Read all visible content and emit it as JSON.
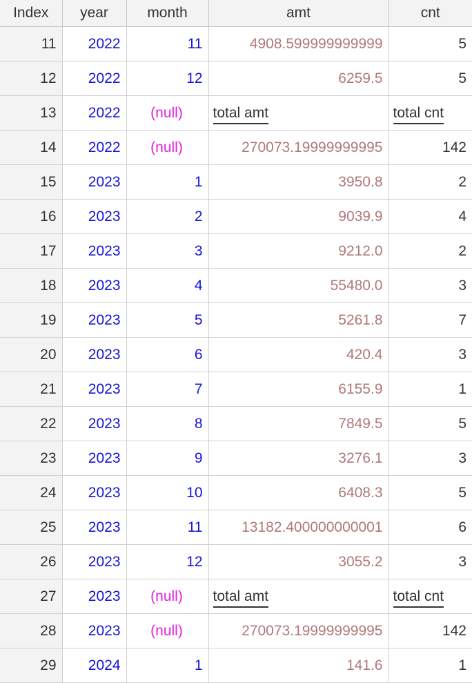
{
  "columns": [
    "Index",
    "year",
    "month",
    "amt",
    "cnt"
  ],
  "rows": [
    {
      "index": "11",
      "year": "2022",
      "month": "11",
      "amt": "4908.599999999999",
      "cnt": "5",
      "month_null": false,
      "label_row": false
    },
    {
      "index": "12",
      "year": "2022",
      "month": "12",
      "amt": "6259.5",
      "cnt": "5",
      "month_null": false,
      "label_row": false
    },
    {
      "index": "13",
      "year": "2022",
      "month": "(null)",
      "amt": "total amt",
      "cnt": "total cnt",
      "month_null": true,
      "label_row": true
    },
    {
      "index": "14",
      "year": "2022",
      "month": "(null)",
      "amt": "270073.19999999995",
      "cnt": "142",
      "month_null": true,
      "label_row": false
    },
    {
      "index": "15",
      "year": "2023",
      "month": "1",
      "amt": "3950.8",
      "cnt": "2",
      "month_null": false,
      "label_row": false
    },
    {
      "index": "16",
      "year": "2023",
      "month": "2",
      "amt": "9039.9",
      "cnt": "4",
      "month_null": false,
      "label_row": false
    },
    {
      "index": "17",
      "year": "2023",
      "month": "3",
      "amt": "9212.0",
      "cnt": "2",
      "month_null": false,
      "label_row": false
    },
    {
      "index": "18",
      "year": "2023",
      "month": "4",
      "amt": "55480.0",
      "cnt": "3",
      "month_null": false,
      "label_row": false
    },
    {
      "index": "19",
      "year": "2023",
      "month": "5",
      "amt": "5261.8",
      "cnt": "7",
      "month_null": false,
      "label_row": false
    },
    {
      "index": "20",
      "year": "2023",
      "month": "6",
      "amt": "420.4",
      "cnt": "3",
      "month_null": false,
      "label_row": false
    },
    {
      "index": "21",
      "year": "2023",
      "month": "7",
      "amt": "6155.9",
      "cnt": "1",
      "month_null": false,
      "label_row": false
    },
    {
      "index": "22",
      "year": "2023",
      "month": "8",
      "amt": "7849.5",
      "cnt": "5",
      "month_null": false,
      "label_row": false
    },
    {
      "index": "23",
      "year": "2023",
      "month": "9",
      "amt": "3276.1",
      "cnt": "3",
      "month_null": false,
      "label_row": false
    },
    {
      "index": "24",
      "year": "2023",
      "month": "10",
      "amt": "6408.3",
      "cnt": "5",
      "month_null": false,
      "label_row": false
    },
    {
      "index": "25",
      "year": "2023",
      "month": "11",
      "amt": "13182.400000000001",
      "cnt": "6",
      "month_null": false,
      "label_row": false
    },
    {
      "index": "26",
      "year": "2023",
      "month": "12",
      "amt": "3055.2",
      "cnt": "3",
      "month_null": false,
      "label_row": false
    },
    {
      "index": "27",
      "year": "2023",
      "month": "(null)",
      "amt": "total amt",
      "cnt": "total cnt",
      "month_null": true,
      "label_row": true
    },
    {
      "index": "28",
      "year": "2023",
      "month": "(null)",
      "amt": "270073.19999999995",
      "cnt": "142",
      "month_null": true,
      "label_row": false
    },
    {
      "index": "29",
      "year": "2024",
      "month": "1",
      "amt": "141.6",
      "cnt": "1",
      "month_null": false,
      "label_row": false
    }
  ],
  "colors": {
    "year_text": "#1515d8",
    "month_text": "#1515d8",
    "null_text": "#e020e0",
    "amt_text": "#b07878",
    "header_bg": "#f3f3f3"
  }
}
